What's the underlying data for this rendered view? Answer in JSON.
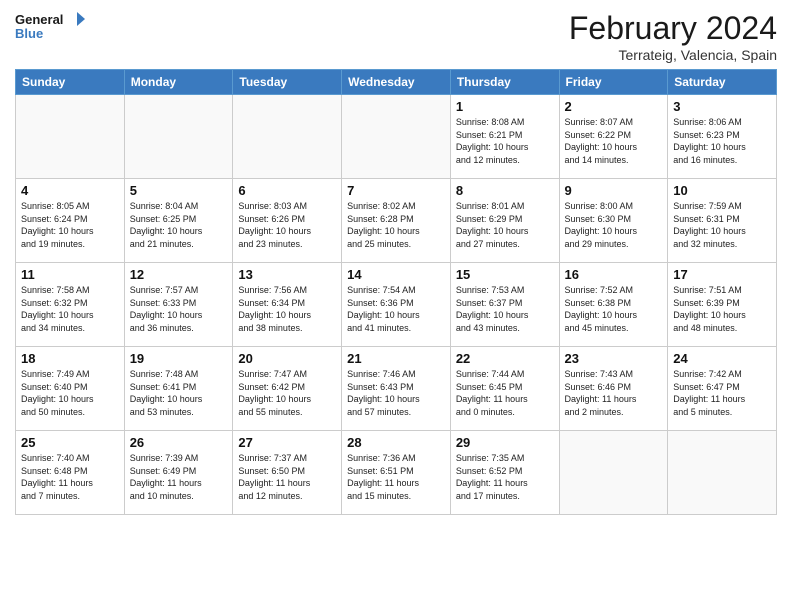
{
  "header": {
    "logo_general": "General",
    "logo_blue": "Blue",
    "month_year": "February 2024",
    "location": "Terrateig, Valencia, Spain"
  },
  "weekdays": [
    "Sunday",
    "Monday",
    "Tuesday",
    "Wednesday",
    "Thursday",
    "Friday",
    "Saturday"
  ],
  "weeks": [
    [
      {
        "day": "",
        "info": ""
      },
      {
        "day": "",
        "info": ""
      },
      {
        "day": "",
        "info": ""
      },
      {
        "day": "",
        "info": ""
      },
      {
        "day": "1",
        "info": "Sunrise: 8:08 AM\nSunset: 6:21 PM\nDaylight: 10 hours\nand 12 minutes."
      },
      {
        "day": "2",
        "info": "Sunrise: 8:07 AM\nSunset: 6:22 PM\nDaylight: 10 hours\nand 14 minutes."
      },
      {
        "day": "3",
        "info": "Sunrise: 8:06 AM\nSunset: 6:23 PM\nDaylight: 10 hours\nand 16 minutes."
      }
    ],
    [
      {
        "day": "4",
        "info": "Sunrise: 8:05 AM\nSunset: 6:24 PM\nDaylight: 10 hours\nand 19 minutes."
      },
      {
        "day": "5",
        "info": "Sunrise: 8:04 AM\nSunset: 6:25 PM\nDaylight: 10 hours\nand 21 minutes."
      },
      {
        "day": "6",
        "info": "Sunrise: 8:03 AM\nSunset: 6:26 PM\nDaylight: 10 hours\nand 23 minutes."
      },
      {
        "day": "7",
        "info": "Sunrise: 8:02 AM\nSunset: 6:28 PM\nDaylight: 10 hours\nand 25 minutes."
      },
      {
        "day": "8",
        "info": "Sunrise: 8:01 AM\nSunset: 6:29 PM\nDaylight: 10 hours\nand 27 minutes."
      },
      {
        "day": "9",
        "info": "Sunrise: 8:00 AM\nSunset: 6:30 PM\nDaylight: 10 hours\nand 29 minutes."
      },
      {
        "day": "10",
        "info": "Sunrise: 7:59 AM\nSunset: 6:31 PM\nDaylight: 10 hours\nand 32 minutes."
      }
    ],
    [
      {
        "day": "11",
        "info": "Sunrise: 7:58 AM\nSunset: 6:32 PM\nDaylight: 10 hours\nand 34 minutes."
      },
      {
        "day": "12",
        "info": "Sunrise: 7:57 AM\nSunset: 6:33 PM\nDaylight: 10 hours\nand 36 minutes."
      },
      {
        "day": "13",
        "info": "Sunrise: 7:56 AM\nSunset: 6:34 PM\nDaylight: 10 hours\nand 38 minutes."
      },
      {
        "day": "14",
        "info": "Sunrise: 7:54 AM\nSunset: 6:36 PM\nDaylight: 10 hours\nand 41 minutes."
      },
      {
        "day": "15",
        "info": "Sunrise: 7:53 AM\nSunset: 6:37 PM\nDaylight: 10 hours\nand 43 minutes."
      },
      {
        "day": "16",
        "info": "Sunrise: 7:52 AM\nSunset: 6:38 PM\nDaylight: 10 hours\nand 45 minutes."
      },
      {
        "day": "17",
        "info": "Sunrise: 7:51 AM\nSunset: 6:39 PM\nDaylight: 10 hours\nand 48 minutes."
      }
    ],
    [
      {
        "day": "18",
        "info": "Sunrise: 7:49 AM\nSunset: 6:40 PM\nDaylight: 10 hours\nand 50 minutes."
      },
      {
        "day": "19",
        "info": "Sunrise: 7:48 AM\nSunset: 6:41 PM\nDaylight: 10 hours\nand 53 minutes."
      },
      {
        "day": "20",
        "info": "Sunrise: 7:47 AM\nSunset: 6:42 PM\nDaylight: 10 hours\nand 55 minutes."
      },
      {
        "day": "21",
        "info": "Sunrise: 7:46 AM\nSunset: 6:43 PM\nDaylight: 10 hours\nand 57 minutes."
      },
      {
        "day": "22",
        "info": "Sunrise: 7:44 AM\nSunset: 6:45 PM\nDaylight: 11 hours\nand 0 minutes."
      },
      {
        "day": "23",
        "info": "Sunrise: 7:43 AM\nSunset: 6:46 PM\nDaylight: 11 hours\nand 2 minutes."
      },
      {
        "day": "24",
        "info": "Sunrise: 7:42 AM\nSunset: 6:47 PM\nDaylight: 11 hours\nand 5 minutes."
      }
    ],
    [
      {
        "day": "25",
        "info": "Sunrise: 7:40 AM\nSunset: 6:48 PM\nDaylight: 11 hours\nand 7 minutes."
      },
      {
        "day": "26",
        "info": "Sunrise: 7:39 AM\nSunset: 6:49 PM\nDaylight: 11 hours\nand 10 minutes."
      },
      {
        "day": "27",
        "info": "Sunrise: 7:37 AM\nSunset: 6:50 PM\nDaylight: 11 hours\nand 12 minutes."
      },
      {
        "day": "28",
        "info": "Sunrise: 7:36 AM\nSunset: 6:51 PM\nDaylight: 11 hours\nand 15 minutes."
      },
      {
        "day": "29",
        "info": "Sunrise: 7:35 AM\nSunset: 6:52 PM\nDaylight: 11 hours\nand 17 minutes."
      },
      {
        "day": "",
        "info": ""
      },
      {
        "day": "",
        "info": ""
      }
    ]
  ]
}
